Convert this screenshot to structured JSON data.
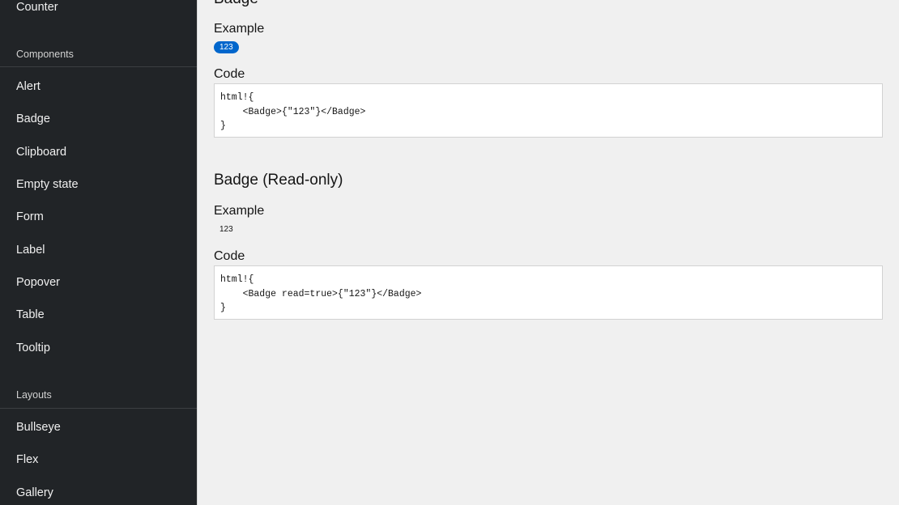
{
  "sidebar": {
    "top_item": "Counter",
    "components_heading": "Components",
    "components": [
      "Alert",
      "Badge",
      "Clipboard",
      "Empty state",
      "Form",
      "Label",
      "Popover",
      "Table",
      "Tooltip"
    ],
    "layouts_heading": "Layouts",
    "layouts": [
      "Bullseye",
      "Flex",
      "Gallery"
    ]
  },
  "main": {
    "section1": {
      "title": "Badge",
      "example_heading": "Example",
      "badge_value": "123",
      "code_heading": "Code",
      "code_lines": [
        "html!{",
        "    <Badge>{\"123\"}</Badge>",
        "}"
      ]
    },
    "section2": {
      "title": "Badge (Read-only)",
      "example_heading": "Example",
      "badge_value": "123",
      "code_heading": "Code",
      "code_lines": [
        "html!{",
        "    <Badge read=true>{\"123\"}</Badge>",
        "}"
      ]
    }
  },
  "colors": {
    "sidebar_bg": "#212427",
    "page_bg": "#f0f0f0",
    "badge_unread": "#0066cc",
    "code_bg": "#ffffff"
  }
}
